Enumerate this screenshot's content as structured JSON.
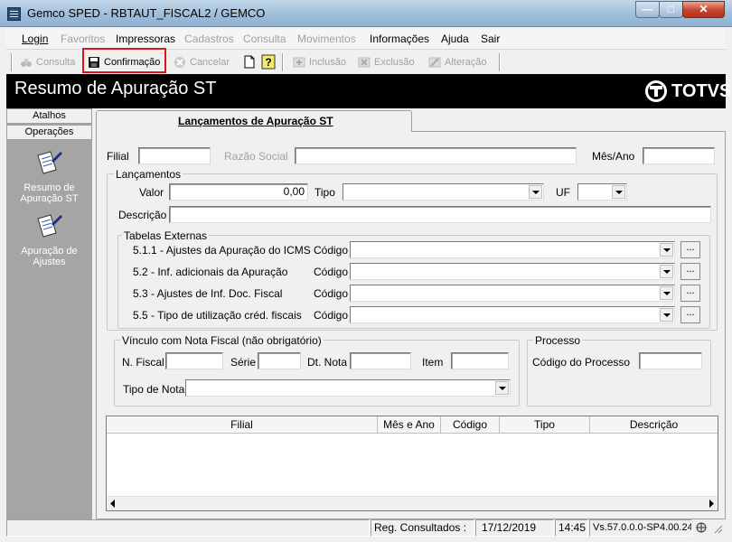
{
  "window": {
    "title": "Gemco SPED - RBTAUT_FISCAL2 / GEMCO",
    "min": "—",
    "max": "□",
    "close": "✕"
  },
  "menu": [
    "Login",
    "Favoritos",
    "Impressoras",
    "Cadastros",
    "Consulta",
    "Movimentos",
    "Informações",
    "Ajuda",
    "Sair"
  ],
  "toolbar": {
    "consulta": "Consulta",
    "confirmacao": "Confirmação",
    "cancelar": "Cancelar",
    "inclusao": "Inclusão",
    "exclusao": "Exclusão",
    "alteracao": "Alteração"
  },
  "banner": {
    "title": "Resumo de Apuração ST",
    "logo": "TOTVS"
  },
  "left_panel": {
    "tabs": [
      "Atalhos",
      "Operações"
    ],
    "items": [
      {
        "label_1": "Resumo de",
        "label_2": "Apuração ST"
      },
      {
        "label_1": "Apuração de",
        "label_2": "Ajustes"
      }
    ]
  },
  "tab": {
    "label": "Lançamentos de Apuração ST"
  },
  "header_fields": {
    "filial": "Filial",
    "razao_social": "Razão Social",
    "mes_ano": "Mês/Ano"
  },
  "lancamentos": {
    "title": "Lançamentos",
    "valor_label": "Valor",
    "valor_value": "0,00",
    "tipo_label": "Tipo",
    "uf_label": "UF",
    "descricao_label": "Descrição"
  },
  "tabelas_externas": {
    "title": "Tabelas Externas",
    "codigo_label": "Código",
    "dots": "...",
    "rows": [
      "5.1.1 - Ajustes da Apuração do ICMS",
      "5.2 - Inf. adicionais da Apuração",
      "5.3 - Ajustes de Inf. Doc. Fiscal",
      "5.5 - Tipo de utilização créd. fiscais"
    ]
  },
  "vinculo": {
    "title": "Vínculo com Nota Fiscal (não obrigatório)",
    "n_fiscal": "N. Fiscal",
    "serie": "Série",
    "dt_nota": "Dt. Nota",
    "item": "Item",
    "tipo_nota": "Tipo de Nota"
  },
  "processo": {
    "title": "Processo",
    "codigo": "Código do Processo"
  },
  "grid": {
    "columns": [
      "Filial",
      "Mês e Ano",
      "Código",
      "Tipo",
      "Descrição"
    ]
  },
  "status": {
    "reg": "Reg. Consultados :",
    "date": "17/12/2019",
    "time": "14:45",
    "version": "Vs.57.0.0.0-SP4.00.24"
  }
}
